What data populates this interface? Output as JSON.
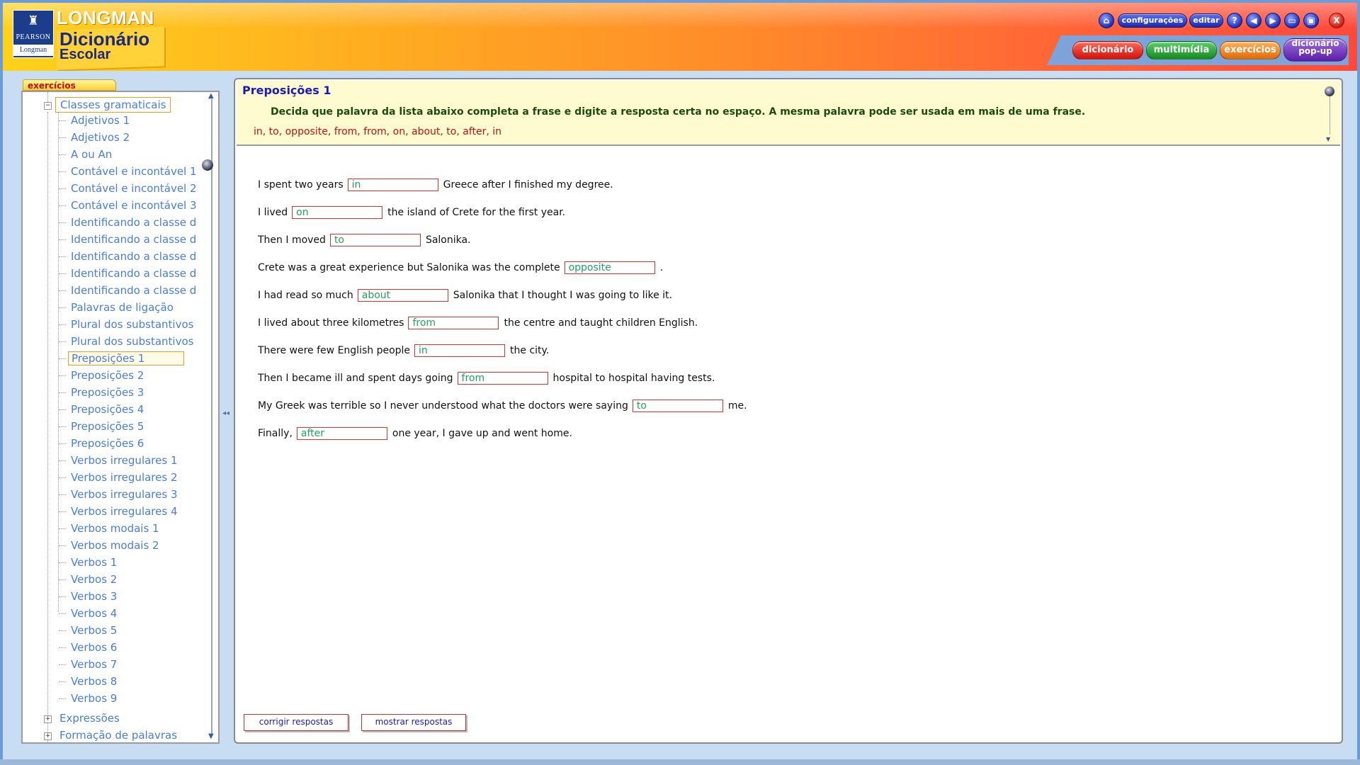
{
  "brand": {
    "publisher_top": "PEARSON",
    "publisher_bottom": "Longman",
    "name": "LONGMAN",
    "title_line1": "Dicionário",
    "title_line2": "Escolar"
  },
  "toolbar": {
    "home_icon": "home-icon",
    "settings_label": "configurações",
    "edit_label": "editar",
    "help_glyph": "?",
    "close_glyph": "X"
  },
  "nav": {
    "dictionary_label": "dicionário",
    "multimedia_label": "multimídia",
    "exercises_label": "exercícios",
    "popup_line1": "dicionário",
    "popup_line2": "pop-up"
  },
  "left_panel": {
    "tab_label": "exercícios",
    "root_category": "Classes gramaticais",
    "items": [
      "Adjetivos 1",
      "Adjetivos 2",
      "A ou An",
      "Contável e incontável 1",
      "Contável e incontável 2",
      "Contável e incontável 3",
      "Identificando a classe d",
      "Identificando a classe d",
      "Identificando a classe d",
      "Identificando a classe d",
      "Identificando a classe d",
      "Palavras de ligação",
      "Plural dos substantivos",
      "Plural dos substantivos",
      "Preposições 1",
      "Preposições 2",
      "Preposições 3",
      "Preposições 4",
      "Preposições 5",
      "Preposições 6",
      "Verbos irregulares 1",
      "Verbos irregulares 2",
      "Verbos irregulares 3",
      "Verbos irregulares 4",
      "Verbos modais 1",
      "Verbos modais 2",
      "Verbos 1",
      "Verbos 2",
      "Verbos 3",
      "Verbos 4",
      "Verbos 5",
      "Verbos 6",
      "Verbos 7",
      "Verbos 8",
      "Verbos 9"
    ],
    "selected_index": 14,
    "other_categories": [
      "Expressões",
      "Formação de palavras"
    ]
  },
  "exercise": {
    "title": "Preposições 1",
    "instructions": "Decida que palavra da lista abaixo completa a frase e digite a resposta certa no espaço. A mesma palavra pode ser usada em mais de uma frase.",
    "word_list": "in, to, opposite, from, from, on, about, to, after, in",
    "sentences": [
      {
        "before": "I spent two years",
        "answer": "in",
        "after": "Greece after I finished my degree."
      },
      {
        "before": "I lived",
        "answer": "on",
        "after": "the island of Crete for the first year."
      },
      {
        "before": "Then I moved",
        "answer": "to",
        "after": "Salonika."
      },
      {
        "before": "Crete was a great experience but Salonika was the complete",
        "answer": "opposite",
        "after": "."
      },
      {
        "before": "I had read so much",
        "answer": "about",
        "after": "Salonika that I thought I was going to like it."
      },
      {
        "before": "I lived about three kilometres",
        "answer": "from",
        "after": "the centre and taught children English."
      },
      {
        "before": "There were few English people",
        "answer": "in",
        "after": "the city."
      },
      {
        "before": "Then I became ill and spent days going",
        "answer": "from",
        "after": "hospital to hospital having tests."
      },
      {
        "before": "My Greek was terrible so I never understood what the doctors were saying",
        "answer": "to",
        "after": "me."
      },
      {
        "before": "Finally,",
        "answer": "after",
        "after": "one year, I gave up and went home."
      }
    ],
    "check_button": "corrigir respostas",
    "show_button": "mostrar respostas"
  },
  "colors": {
    "answer_text": "#20a060",
    "answer_border": "#e03030",
    "tree_link": "#4a7ce0",
    "title_blue": "#1a1ac0"
  }
}
